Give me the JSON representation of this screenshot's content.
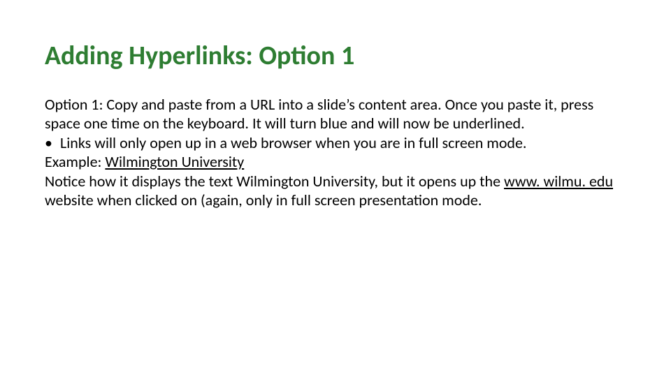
{
  "title": "Adding Hyperlinks: Option 1",
  "para1": "Option 1: Copy and paste from a URL into a slide’s content area. Once you paste it, press space one time on the keyboard. It will turn blue and will now be underlined.",
  "bullet": {
    "marker": "•",
    "text": "Links will only open up in a web browser when you are in full screen mode."
  },
  "example": {
    "prefix": "Example: ",
    "link_text": "Wilmington University"
  },
  "notice": {
    "pre": "Notice how it displays the text Wilmington University, but it opens up the ",
    "link_text": "www. wilmu. edu",
    "post": " website when clicked on (again, only in full screen presentation mode."
  }
}
